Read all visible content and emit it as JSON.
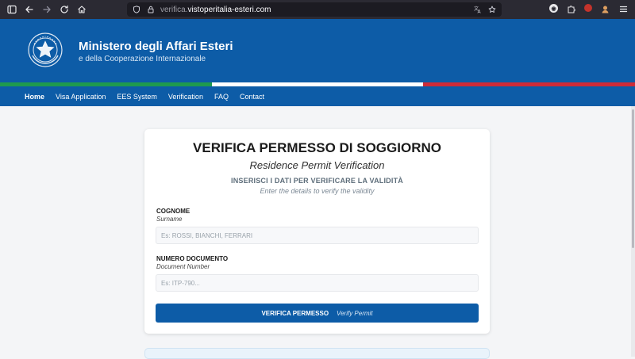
{
  "browser": {
    "url_subdomain": "verifica.",
    "url_domain": "vistoperitalia-esteri.com",
    "icons": {
      "sidebar": "sidebar-icon",
      "back": "back-arrow-icon",
      "forward": "forward-arrow-icon",
      "reload": "reload-icon",
      "home": "home-icon",
      "shield": "shield-icon",
      "lock": "lock-icon",
      "translate": "translate-icon",
      "bookmark": "star-icon",
      "extensions": "puzzle-icon",
      "menu": "hamburger-menu-icon"
    }
  },
  "header": {
    "emblem": "italian-republic-emblem",
    "title": "Ministero degli Affari Esteri",
    "subtitle": "e della Cooperazione Internazionale",
    "tricolor": [
      "#1e9a4f",
      "#ffffff",
      "#ce2b37"
    ],
    "background": "#0d5ca7"
  },
  "nav": {
    "items": [
      {
        "label": "Home",
        "active": true
      },
      {
        "label": "Visa Application"
      },
      {
        "label": "EES System"
      },
      {
        "label": "Verification"
      },
      {
        "label": "FAQ"
      },
      {
        "label": "Contact"
      }
    ]
  },
  "form": {
    "title": "VERIFICA PERMESSO DI SOGGIORNO",
    "subtitle": "Residence Permit Verification",
    "instructions": "INSERISCI I DATI PER VERIFICARE LA VALIDITÀ",
    "instructions_en": "Enter the details to verify the validity",
    "surname_label": "COGNOME",
    "surname_label_en": "Surname",
    "surname_value": "",
    "surname_placeholder": "Es: ROSSI, BIANCHI, FERRARI",
    "document_label": "NUMERO DOCUMENTO",
    "document_label_en": "Document Number",
    "document_value": "",
    "document_placeholder": "Es: ITP-790...",
    "button_label": "VERIFICA PERMESSO",
    "button_label_en": "Verify Permit"
  }
}
